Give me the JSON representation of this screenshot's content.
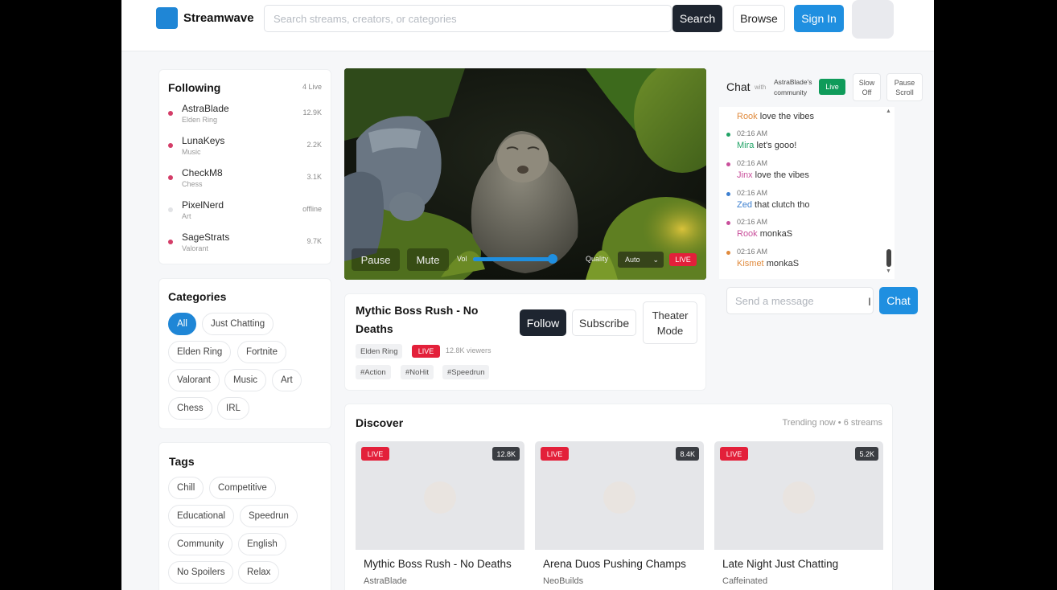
{
  "brand": {
    "name": "Streamwave",
    "accent": "#1f86d6",
    "dark_button": "#1e2530",
    "live_red": "#e3203a"
  },
  "search": {
    "placeholder": "Search streams, creators, or categories",
    "button_label": "Search"
  },
  "nav": {
    "browse_label": "Browse",
    "signin_label": "Sign In"
  },
  "following": {
    "title": "Following",
    "live_count": "4 Live",
    "items": [
      {
        "name": "AstraBlade",
        "game": "Elden Ring",
        "viewers": "12.9K",
        "online": true
      },
      {
        "name": "LunaKeys",
        "game": "Music",
        "viewers": "2.2K",
        "online": true
      },
      {
        "name": "CheckM8",
        "game": "Chess",
        "viewers": "3.1K",
        "online": true
      },
      {
        "name": "PixelNerd",
        "game": "Art",
        "viewers": "offline",
        "online": false
      },
      {
        "name": "SageStrats",
        "game": "Valorant",
        "viewers": "9.7K",
        "online": true
      }
    ]
  },
  "categories": {
    "title": "Categories",
    "items": [
      "All",
      "Just Chatting",
      "Elden Ring",
      "Fortnite",
      "Valorant",
      "Music",
      "Art",
      "Chess",
      "IRL"
    ],
    "active": "All"
  },
  "tags": {
    "title": "Tags",
    "items": [
      "Chill",
      "Competitive",
      "Educational",
      "Speedrun",
      "Community",
      "English",
      "No Spoilers",
      "Relax"
    ]
  },
  "player": {
    "pause_label": "Pause",
    "mute_label": "Mute",
    "vol_label": "Vol",
    "volume": 0.97,
    "quality_label": "Quality",
    "quality_value": "Auto",
    "live_label": "LIVE"
  },
  "stream": {
    "title": "Mythic Boss Rush - No Deaths",
    "follow_label": "Follow",
    "subscribe_label": "Subscribe",
    "theater_label": "Theater Mode",
    "category": "Elden Ring",
    "live_label": "LIVE",
    "viewers": "12.8K viewers",
    "tags": [
      "#Action",
      "#NoHit",
      "#Speedrun"
    ]
  },
  "chat": {
    "title": "Chat",
    "with_label": "with",
    "community": "AstraBlade's community",
    "live_label": "Live",
    "slow_label": "Slow Off",
    "pause_scroll_label": "Pause Scroll",
    "first_line": {
      "user": "Rook",
      "text": "love the vibes",
      "color": "#e08a3c"
    },
    "messages": [
      {
        "time": "02:16 AM",
        "user": "Mira",
        "text": "let's gooo!",
        "color": "#21a366"
      },
      {
        "time": "02:16 AM",
        "user": "Jinx",
        "text": "love the vibes",
        "color": "#c94f9b"
      },
      {
        "time": "02:16 AM",
        "user": "Zed",
        "text": "that clutch tho",
        "color": "#3c7fd0"
      },
      {
        "time": "02:16 AM",
        "user": "Rook",
        "text": "monkaS",
        "color": "#c94f9b"
      },
      {
        "time": "02:16 AM",
        "user": "Kismet",
        "text": "monkaS",
        "color": "#e08a3c"
      }
    ],
    "input_placeholder": "Send a message",
    "send_label": "Chat"
  },
  "discover": {
    "title": "Discover",
    "meta": "Trending now • 6 streams",
    "cards": [
      {
        "live": "LIVE",
        "viewers": "12.8K",
        "title": "Mythic Boss Rush - No Deaths",
        "creator": "AstraBlade"
      },
      {
        "live": "LIVE",
        "viewers": "8.4K",
        "title": "Arena Duos Pushing Champs",
        "creator": "NeoBuilds"
      },
      {
        "live": "LIVE",
        "viewers": "5.2K",
        "title": "Late Night Just Chatting",
        "creator": "Caffeinated"
      }
    ]
  }
}
